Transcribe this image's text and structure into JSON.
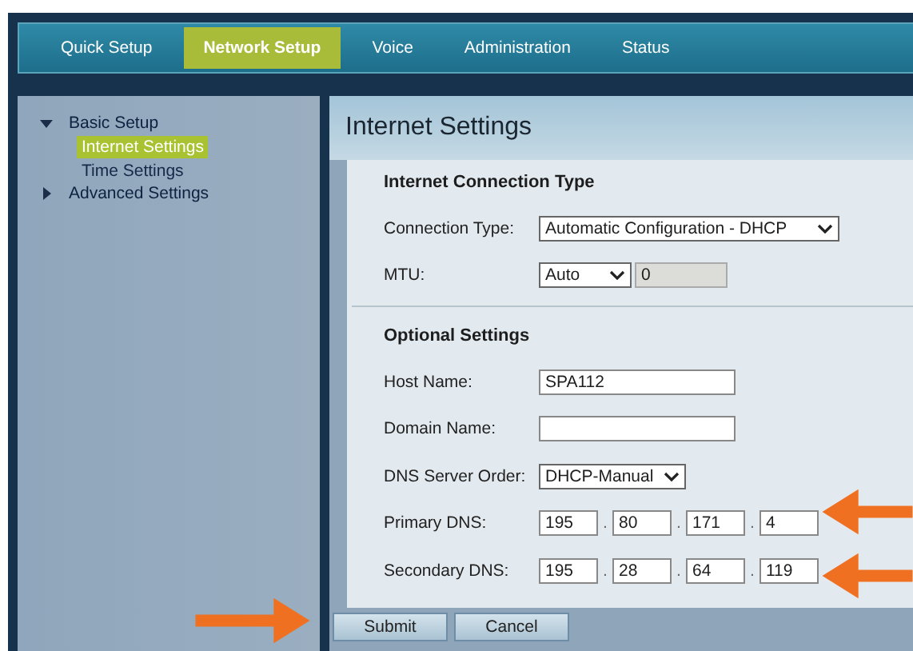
{
  "nav_tabs": [
    {
      "label": "Quick Setup",
      "selected": false
    },
    {
      "label": "Network Setup",
      "selected": true
    },
    {
      "label": "Voice",
      "selected": false
    },
    {
      "label": "Administration",
      "selected": false
    },
    {
      "label": "Status",
      "selected": false
    }
  ],
  "sidebar": {
    "items": [
      {
        "label": "Basic Setup",
        "expanded": true,
        "children": [
          {
            "label": "Internet Settings",
            "selected": true
          },
          {
            "label": "Time Settings",
            "selected": false
          }
        ]
      },
      {
        "label": "Advanced Settings",
        "expanded": false
      }
    ]
  },
  "page_title": "Internet Settings",
  "connection_section": {
    "heading": "Internet Connection Type",
    "connection_type": {
      "label": "Connection Type:",
      "value": "Automatic Configuration - DHCP"
    },
    "mtu": {
      "label": "MTU:",
      "value": "Auto",
      "size": "0"
    }
  },
  "optional_section": {
    "heading": "Optional Settings",
    "host_name": {
      "label": "Host Name:",
      "value": "SPA112"
    },
    "domain_name": {
      "label": "Domain Name:"
    },
    "dns_server_order": {
      "label": "DNS Server Order:",
      "value": "DHCP-Manual"
    },
    "dns": [
      {
        "label": "Primary DNS:",
        "octets": [
          "195",
          "80",
          "171",
          "4"
        ],
        "separators": [
          ".",
          ".",
          "."
        ]
      },
      {
        "label": "Secondary DNS:",
        "octets": [
          "195",
          "28",
          "64",
          "119"
        ],
        "separators": [
          ".",
          ".",
          "."
        ]
      }
    ]
  },
  "buttons": [
    "Submit",
    "Cancel"
  ]
}
